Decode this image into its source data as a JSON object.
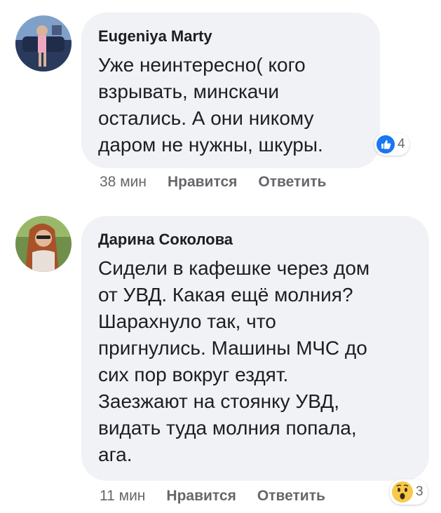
{
  "comments": [
    {
      "author": "Eugeniya Marty",
      "text": "Уже неинтересно( кого\nвзрывать, минскачи\nостались. А они никому\nдаром не нужны, шкуры.",
      "time": "38 мин",
      "like_label": "Нравится",
      "reply_label": "Ответить",
      "reaction": {
        "icon": "like-icon",
        "count": "4"
      }
    },
    {
      "author": "Дарина Соколова",
      "text": "Сидели в кафешке через дом\nот УВД. Какая ещё молния?\nШарахнуло так, что\nпригнулись. Машины МЧС до\nсих пор вокруг ездят.\nЗаезжают на стоянку УВД,\nвидать туда молния попала,\nага.",
      "time": "11 мин",
      "like_label": "Нравится",
      "reply_label": "Ответить",
      "reaction": {
        "icon": "wow-icon",
        "count": "3"
      }
    }
  ]
}
